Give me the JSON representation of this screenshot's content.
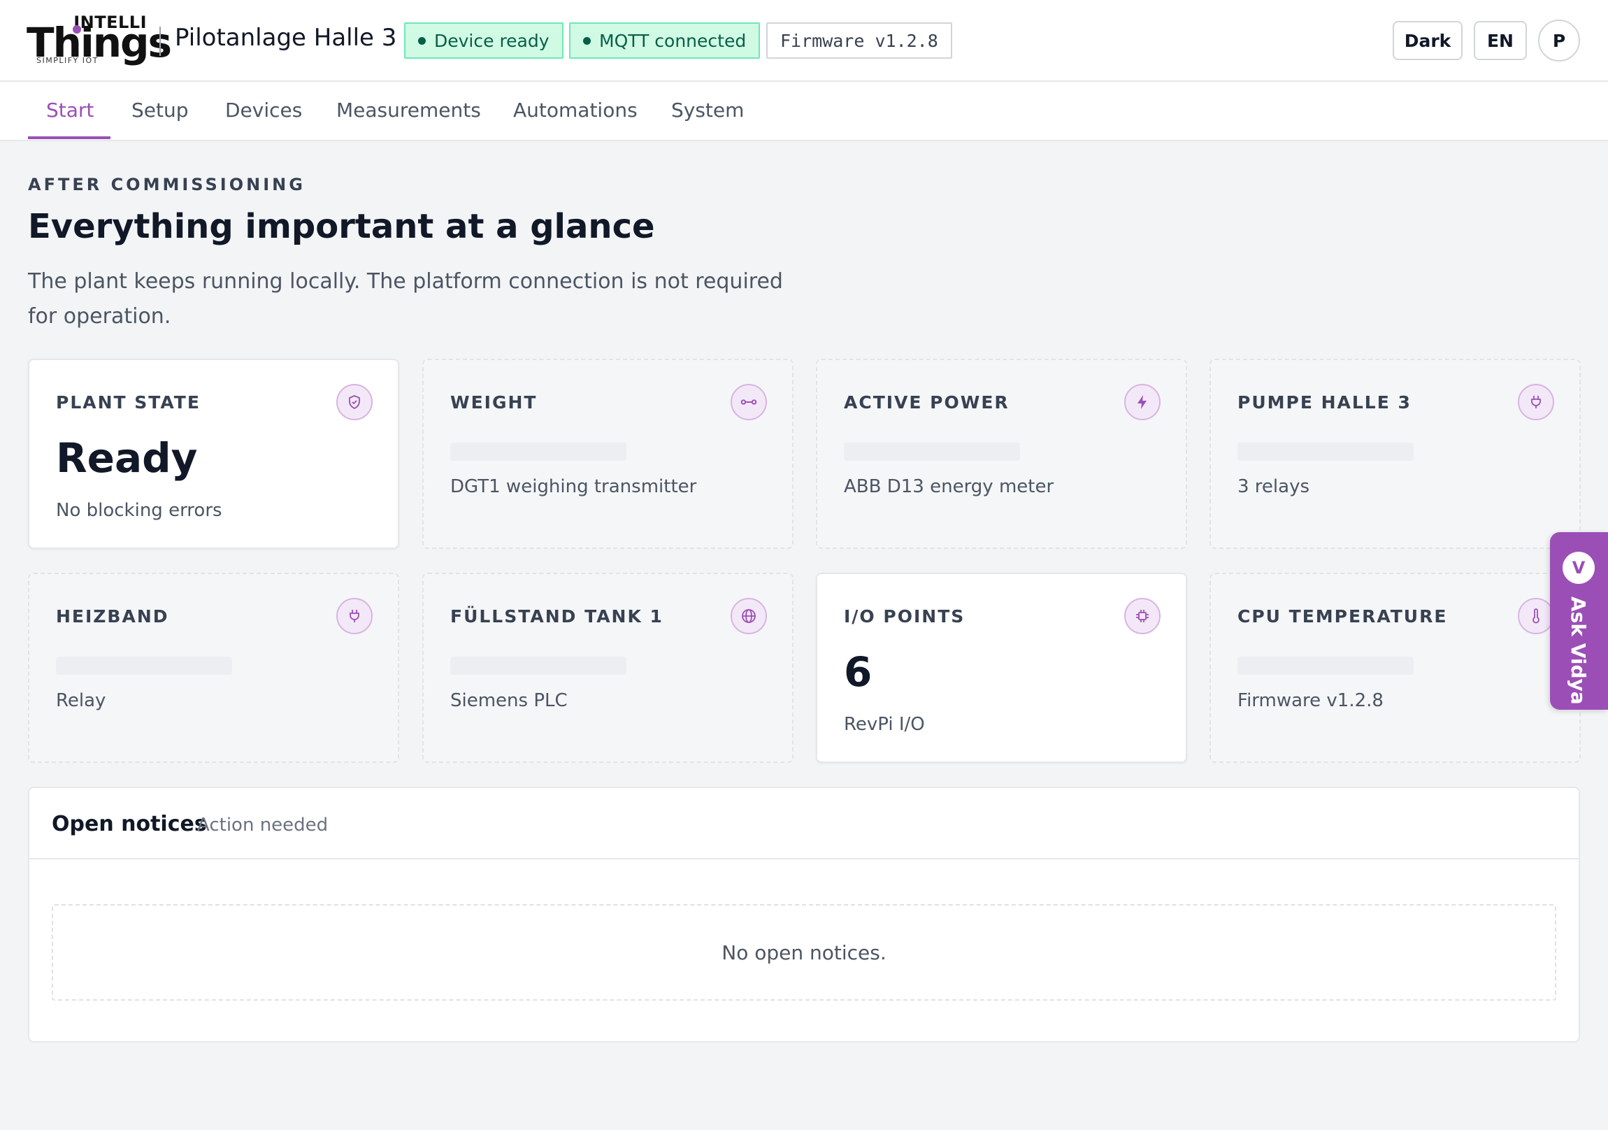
{
  "brand": {
    "logo_top": "INTELLI",
    "logo_main": "Things",
    "logo_tagline": "SIMPLIFY IOT",
    "accent": "#9b4fb6"
  },
  "header": {
    "plant_name": "Pilotanlage Halle 3",
    "badges": {
      "device": "Device ready",
      "mqtt": "MQTT connected",
      "firmware": "Firmware v1.2.8"
    },
    "theme_button": "Dark",
    "language_button": "EN",
    "avatar_initial": "P"
  },
  "tabs": [
    {
      "label": "Start",
      "active": true
    },
    {
      "label": "Setup"
    },
    {
      "label": "Devices"
    },
    {
      "label": "Measurements"
    },
    {
      "label": "Automations"
    },
    {
      "label": "System"
    }
  ],
  "intro": {
    "eyebrow": "AFTER COMMISSIONING",
    "title": "Everything important at a glance",
    "subtitle": "The plant keeps running locally. The platform connection is not required for operation."
  },
  "cards": [
    {
      "label": "PLANT STATE",
      "value": "Ready",
      "desc": "No blocking errors",
      "icon": "shield-check-icon"
    },
    {
      "label": "WEIGHT",
      "desc": "DGT1 weighing transmitter",
      "icon": "link-icon"
    },
    {
      "label": "ACTIVE POWER",
      "desc": "ABB D13 energy meter",
      "icon": "bolt-icon"
    },
    {
      "label": "PUMPE HALLE 3",
      "desc": "3 relays",
      "icon": "plug-icon"
    },
    {
      "label": "HEIZBAND",
      "desc": "Relay",
      "icon": "plug-icon"
    },
    {
      "label": "FÜLLSTAND TANK 1",
      "desc": "Siemens PLC",
      "icon": "globe-icon"
    },
    {
      "label": "I/O POINTS",
      "value": "6",
      "desc": "RevPi I/O",
      "icon": "chip-icon"
    },
    {
      "label": "CPU TEMPERATURE",
      "desc": "Firmware v1.2.8",
      "icon": "thermometer-icon"
    }
  ],
  "notices": {
    "title": "Open notices",
    "subtitle": "Action needed",
    "empty": "No open notices."
  },
  "assistant": {
    "initial": "V",
    "label": "Ask Vidya"
  }
}
